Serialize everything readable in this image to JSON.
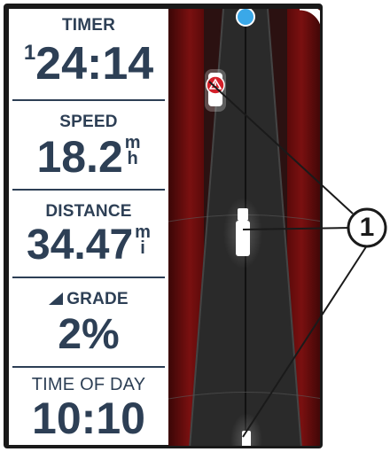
{
  "fields": {
    "timer": {
      "label": "TIMER",
      "lap": "1",
      "value": "24:14"
    },
    "speed": {
      "label": "SPEED",
      "value": "18.2",
      "unit_top": "m",
      "unit_bottom": "h"
    },
    "distance": {
      "label": "DISTANCE",
      "value": "34.47",
      "unit_top": "m",
      "unit_bottom": "i"
    },
    "grade": {
      "label": "GRADE",
      "value": "2%",
      "icon": "grade-triangle-icon"
    },
    "time_of_day": {
      "label": "TIME OF DAY",
      "value": "10:10"
    }
  },
  "callout": {
    "number": "1"
  },
  "colors": {
    "text": "#2d3f55",
    "road": "#2a2a2a",
    "danger_zone": "#7a1010",
    "alert": "#d4202a",
    "rider_dot": "#3aa8e8",
    "vehicle": "#ffffff"
  },
  "icons": [
    "rider-position-icon",
    "radar-signal-icon",
    "alert-triangle-icon",
    "vehicle-icon"
  ]
}
